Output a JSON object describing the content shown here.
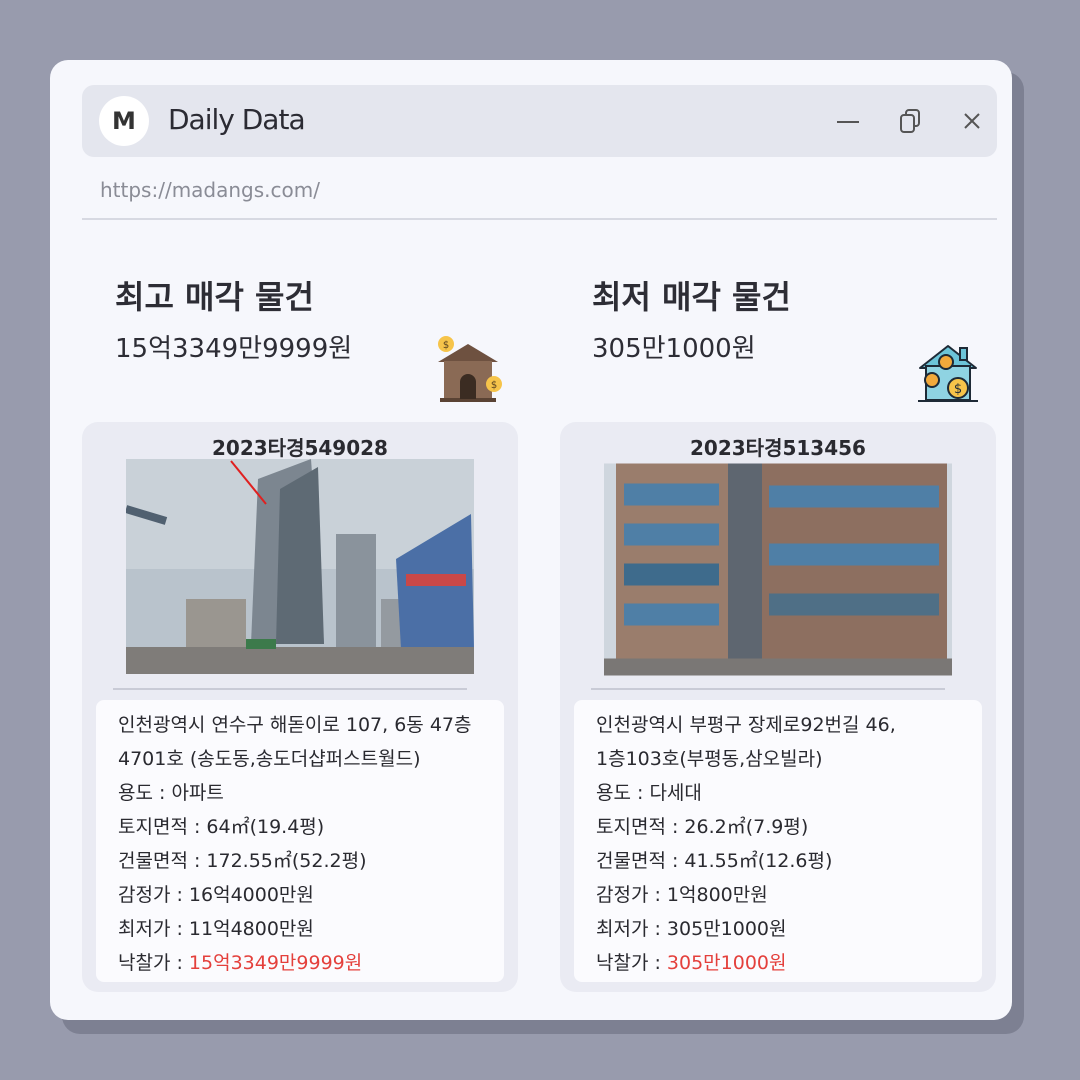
{
  "app": {
    "logo_letter": "M",
    "title": "Daily Data",
    "url": "https://madangs.com/"
  },
  "icons": {
    "minimize": "minimize-icon",
    "restore": "restore-icon",
    "close": "close-icon",
    "house_high": "house-money-icon",
    "house_low": "house-coins-icon"
  },
  "colors": {
    "accent_red": "#e4403c",
    "background": "#989bad",
    "window": "#f6f7fc"
  },
  "highest": {
    "heading": "최고 매각 물건",
    "price": "15억3349만9999원",
    "case_no": "2023타경549028",
    "address1": "인천광역시 연수구 해돋이로 107, 6동 47층",
    "address2": "4701호 (송도동,송도더샵퍼스트월드)",
    "usage": "용도 : 아파트",
    "land_area": "토지면적 : 64㎡(19.4평)",
    "building_area": "건물면적 : 172.55㎡(52.2평)",
    "appraisal": "감정가 : 16억4000만원",
    "minimum": "최저가 : 11억4800만원",
    "winning_label": "낙찰가 : ",
    "winning_value": "15억3349만9999원"
  },
  "lowest": {
    "heading": "최저 매각 물건",
    "price": "305만1000원",
    "case_no": "2023타경513456",
    "address1": "인천광역시 부평구 장제로92번길 46,",
    "address2": "1층103호(부평동,삼오빌라)",
    "usage": "용도 :  다세대",
    "land_area": "토지면적 : 26.2㎡(7.9평)",
    "building_area": "건물면적 : 41.55㎡(12.6평)",
    "appraisal": "감정가 : 1억800만원",
    "minimum": "최저가 : 305만1000원",
    "winning_label": "낙찰가 : ",
    "winning_value": "305만1000원"
  }
}
